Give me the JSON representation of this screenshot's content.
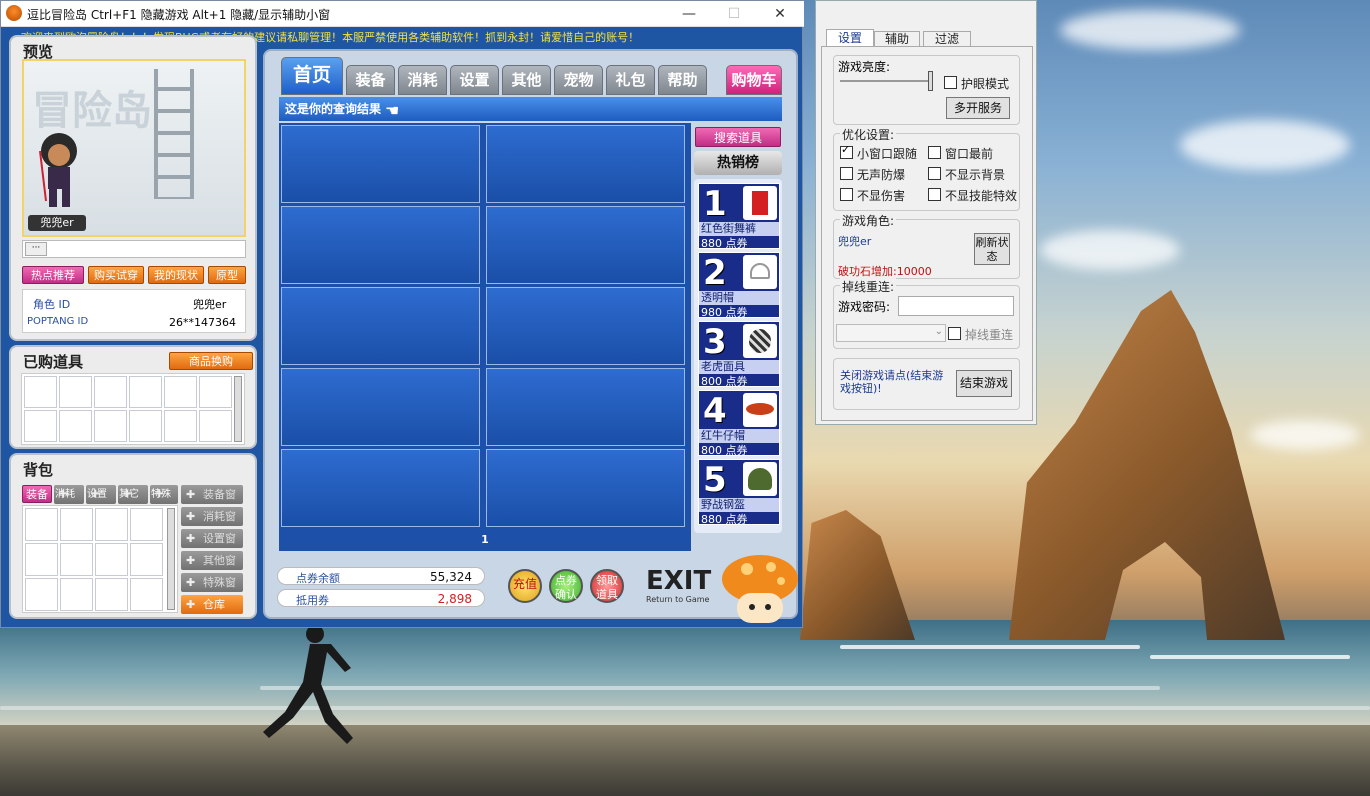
{
  "game_window": {
    "title": "逗比冒险岛    Ctrl+F1 隐藏游戏 Alt+1 隐藏/显示辅助小窗",
    "minimize": "—",
    "maximize": "☐",
    "close": "✕",
    "marquee": "欢迎来到欧泡冒险岛！！！发现BUG或者有好的建议请私聊管理！本服严禁使用各类辅助软件！抓到永封！请爱惜自己的账号！"
  },
  "preview": {
    "title": "预览",
    "char_name": "兜兜er",
    "buttons": [
      "热点推荐",
      "购买试穿",
      "我的现状",
      "原型"
    ],
    "role_label": "角色   ID",
    "role_value": "兜兜er",
    "poptang_label": "POPTANG ID",
    "poptang_value": "26**147364"
  },
  "purchased": {
    "title": "已购道具",
    "exchange_button": "商品换购"
  },
  "bag": {
    "title": "背包",
    "tabs": [
      "装备",
      "消耗",
      "设置",
      "其它",
      "特殊"
    ],
    "side_buttons": [
      "装备窗",
      "消耗窗",
      "设置窗",
      "其他窗",
      "特殊窗"
    ],
    "warehouse": "仓库"
  },
  "shop": {
    "tabs": [
      "首页",
      "装备",
      "消耗",
      "设置",
      "其他",
      "宠物",
      "礼包",
      "帮助"
    ],
    "cart": "购物车",
    "result_text": "这是你的查询结果",
    "page": "1",
    "search_button": "搜索道具",
    "hot_title": "热销榜",
    "hot_items": [
      {
        "rank": "1",
        "name": "红色街舞裤",
        "price": "880  点券"
      },
      {
        "rank": "2",
        "name": "透明帽",
        "price": "980  点券"
      },
      {
        "rank": "3",
        "name": "老虎面具",
        "price": "800  点券"
      },
      {
        "rank": "4",
        "name": "红牛仔帽",
        "price": "800  点券"
      },
      {
        "rank": "5",
        "name": "野战钢盔",
        "price": "880  点券"
      }
    ],
    "points_label": "点券余额",
    "points_value": "55,324",
    "voucher_label": "抵用券",
    "voucher_value": "2,898",
    "recharge": "充值",
    "confirm_points": "点券确认",
    "receive_item": "领取道具",
    "exit": "EXIT",
    "exit_sub": "Return to Game"
  },
  "helper": {
    "tabs": [
      "设置",
      "辅助",
      "过滤"
    ],
    "brightness_label": "游戏亮度:",
    "eye_mode": "护眼模式",
    "multi_open": "多开服务",
    "opt_title": "优化设置:",
    "opts": [
      {
        "label": "小窗口跟随",
        "checked": true
      },
      {
        "label": "窗口最前",
        "checked": false
      },
      {
        "label": "无声防爆",
        "checked": false
      },
      {
        "label": "不显示背景",
        "checked": false
      },
      {
        "label": "不显伤害",
        "checked": false
      },
      {
        "label": "不显技能特效",
        "checked": false
      }
    ],
    "role_title": "游戏角色:",
    "role_name": "兜兜er",
    "refresh": "刷新状态",
    "stone": "破功石增加:10000",
    "reconnect_title": "掉线重连:",
    "password_label": "游戏密码:",
    "reconnect_cb": "掉线重连",
    "close_hint": "关闭游戏请点(结束游戏按钮)!",
    "end_game": "结束游戏"
  }
}
